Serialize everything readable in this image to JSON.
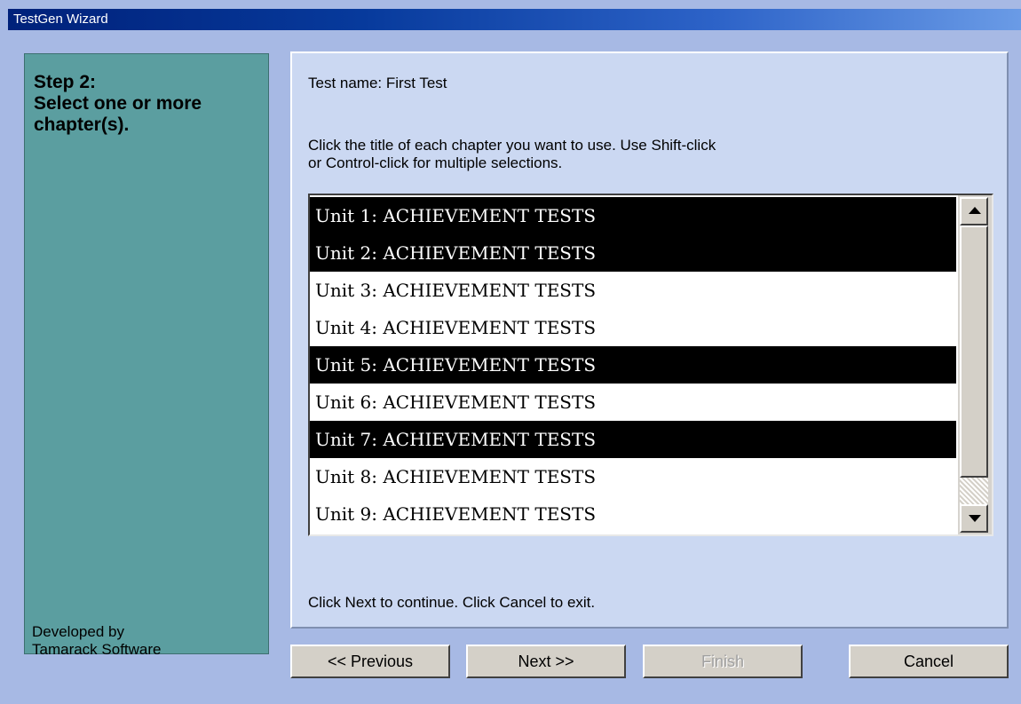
{
  "window": {
    "title": "TestGen Wizard"
  },
  "side_panel": {
    "step_heading": "Step 2:",
    "step_title": "Select one or more chapter(s).",
    "credit_line1": "Developed by",
    "credit_line2": "Tamarack Software"
  },
  "main": {
    "test_name": "Test name: First Test",
    "instructions_line1": "Click the title of each chapter you want to use. Use Shift-click",
    "instructions_line2": "or Control-click for multiple selections.",
    "chapters": [
      {
        "label": "Unit 1: ACHIEVEMENT TESTS",
        "selected": true
      },
      {
        "label": "Unit 2: ACHIEVEMENT TESTS",
        "selected": true
      },
      {
        "label": "Unit 3: ACHIEVEMENT TESTS",
        "selected": false
      },
      {
        "label": "Unit 4: ACHIEVEMENT TESTS",
        "selected": false
      },
      {
        "label": "Unit 5: ACHIEVEMENT TESTS",
        "selected": true
      },
      {
        "label": "Unit 6: ACHIEVEMENT TESTS",
        "selected": false
      },
      {
        "label": "Unit 7: ACHIEVEMENT TESTS",
        "selected": true
      },
      {
        "label": "Unit 8: ACHIEVEMENT TESTS",
        "selected": false
      },
      {
        "label": "Unit 9: ACHIEVEMENT TESTS",
        "selected": false
      }
    ],
    "continue_hint": "Click Next to continue. Click Cancel to exit."
  },
  "buttons": {
    "previous": "<< Previous",
    "next": "Next >>",
    "finish": "Finish",
    "cancel": "Cancel"
  }
}
